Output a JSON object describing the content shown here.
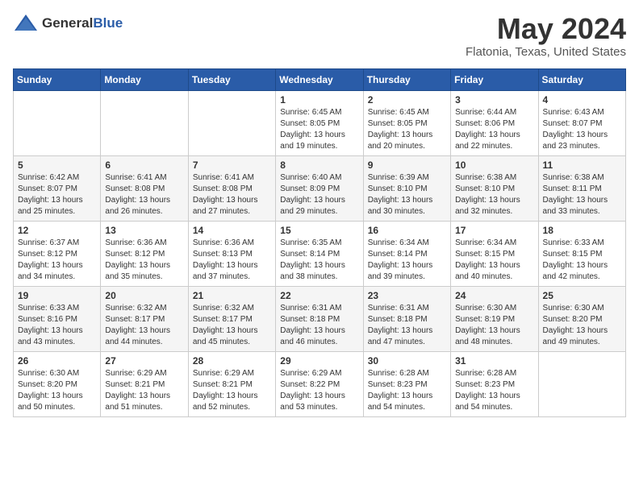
{
  "header": {
    "logo_general": "General",
    "logo_blue": "Blue",
    "month": "May 2024",
    "location": "Flatonia, Texas, United States"
  },
  "days_of_week": [
    "Sunday",
    "Monday",
    "Tuesday",
    "Wednesday",
    "Thursday",
    "Friday",
    "Saturday"
  ],
  "weeks": [
    [
      {
        "day": "",
        "info": ""
      },
      {
        "day": "",
        "info": ""
      },
      {
        "day": "",
        "info": ""
      },
      {
        "day": "1",
        "info": "Sunrise: 6:45 AM\nSunset: 8:05 PM\nDaylight: 13 hours\nand 19 minutes."
      },
      {
        "day": "2",
        "info": "Sunrise: 6:45 AM\nSunset: 8:05 PM\nDaylight: 13 hours\nand 20 minutes."
      },
      {
        "day": "3",
        "info": "Sunrise: 6:44 AM\nSunset: 8:06 PM\nDaylight: 13 hours\nand 22 minutes."
      },
      {
        "day": "4",
        "info": "Sunrise: 6:43 AM\nSunset: 8:07 PM\nDaylight: 13 hours\nand 23 minutes."
      }
    ],
    [
      {
        "day": "5",
        "info": "Sunrise: 6:42 AM\nSunset: 8:07 PM\nDaylight: 13 hours\nand 25 minutes."
      },
      {
        "day": "6",
        "info": "Sunrise: 6:41 AM\nSunset: 8:08 PM\nDaylight: 13 hours\nand 26 minutes."
      },
      {
        "day": "7",
        "info": "Sunrise: 6:41 AM\nSunset: 8:08 PM\nDaylight: 13 hours\nand 27 minutes."
      },
      {
        "day": "8",
        "info": "Sunrise: 6:40 AM\nSunset: 8:09 PM\nDaylight: 13 hours\nand 29 minutes."
      },
      {
        "day": "9",
        "info": "Sunrise: 6:39 AM\nSunset: 8:10 PM\nDaylight: 13 hours\nand 30 minutes."
      },
      {
        "day": "10",
        "info": "Sunrise: 6:38 AM\nSunset: 8:10 PM\nDaylight: 13 hours\nand 32 minutes."
      },
      {
        "day": "11",
        "info": "Sunrise: 6:38 AM\nSunset: 8:11 PM\nDaylight: 13 hours\nand 33 minutes."
      }
    ],
    [
      {
        "day": "12",
        "info": "Sunrise: 6:37 AM\nSunset: 8:12 PM\nDaylight: 13 hours\nand 34 minutes."
      },
      {
        "day": "13",
        "info": "Sunrise: 6:36 AM\nSunset: 8:12 PM\nDaylight: 13 hours\nand 35 minutes."
      },
      {
        "day": "14",
        "info": "Sunrise: 6:36 AM\nSunset: 8:13 PM\nDaylight: 13 hours\nand 37 minutes."
      },
      {
        "day": "15",
        "info": "Sunrise: 6:35 AM\nSunset: 8:14 PM\nDaylight: 13 hours\nand 38 minutes."
      },
      {
        "day": "16",
        "info": "Sunrise: 6:34 AM\nSunset: 8:14 PM\nDaylight: 13 hours\nand 39 minutes."
      },
      {
        "day": "17",
        "info": "Sunrise: 6:34 AM\nSunset: 8:15 PM\nDaylight: 13 hours\nand 40 minutes."
      },
      {
        "day": "18",
        "info": "Sunrise: 6:33 AM\nSunset: 8:15 PM\nDaylight: 13 hours\nand 42 minutes."
      }
    ],
    [
      {
        "day": "19",
        "info": "Sunrise: 6:33 AM\nSunset: 8:16 PM\nDaylight: 13 hours\nand 43 minutes."
      },
      {
        "day": "20",
        "info": "Sunrise: 6:32 AM\nSunset: 8:17 PM\nDaylight: 13 hours\nand 44 minutes."
      },
      {
        "day": "21",
        "info": "Sunrise: 6:32 AM\nSunset: 8:17 PM\nDaylight: 13 hours\nand 45 minutes."
      },
      {
        "day": "22",
        "info": "Sunrise: 6:31 AM\nSunset: 8:18 PM\nDaylight: 13 hours\nand 46 minutes."
      },
      {
        "day": "23",
        "info": "Sunrise: 6:31 AM\nSunset: 8:18 PM\nDaylight: 13 hours\nand 47 minutes."
      },
      {
        "day": "24",
        "info": "Sunrise: 6:30 AM\nSunset: 8:19 PM\nDaylight: 13 hours\nand 48 minutes."
      },
      {
        "day": "25",
        "info": "Sunrise: 6:30 AM\nSunset: 8:20 PM\nDaylight: 13 hours\nand 49 minutes."
      }
    ],
    [
      {
        "day": "26",
        "info": "Sunrise: 6:30 AM\nSunset: 8:20 PM\nDaylight: 13 hours\nand 50 minutes."
      },
      {
        "day": "27",
        "info": "Sunrise: 6:29 AM\nSunset: 8:21 PM\nDaylight: 13 hours\nand 51 minutes."
      },
      {
        "day": "28",
        "info": "Sunrise: 6:29 AM\nSunset: 8:21 PM\nDaylight: 13 hours\nand 52 minutes."
      },
      {
        "day": "29",
        "info": "Sunrise: 6:29 AM\nSunset: 8:22 PM\nDaylight: 13 hours\nand 53 minutes."
      },
      {
        "day": "30",
        "info": "Sunrise: 6:28 AM\nSunset: 8:23 PM\nDaylight: 13 hours\nand 54 minutes."
      },
      {
        "day": "31",
        "info": "Sunrise: 6:28 AM\nSunset: 8:23 PM\nDaylight: 13 hours\nand 54 minutes."
      },
      {
        "day": "",
        "info": ""
      }
    ]
  ]
}
